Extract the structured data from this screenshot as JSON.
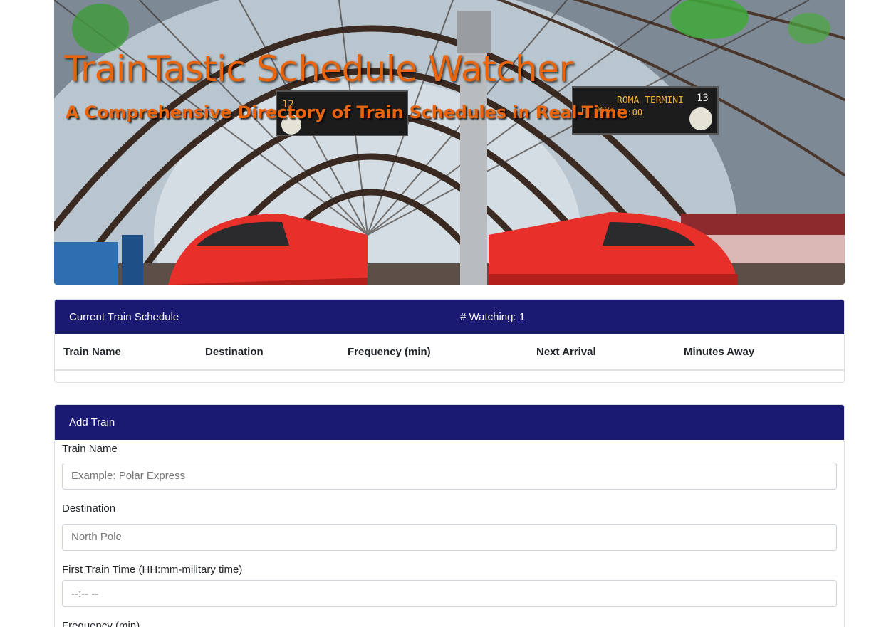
{
  "hero": {
    "title": "TrainTastic Schedule Watcher",
    "subtitle": "A Comprehensive Directory of Train Schedules in Real-Time",
    "board_left": "12",
    "board_right_platform": "13",
    "board_right_dest": "ROMA TERMINI",
    "board_right_train": "FR 9627",
    "board_right_time": "12:00"
  },
  "schedule": {
    "header": "Current Train Schedule",
    "watching": "# Watching: 1",
    "columns": [
      "Train Name",
      "Destination",
      "Frequency (min)",
      "Next Arrival",
      "Minutes Away"
    ],
    "rows": []
  },
  "add_train": {
    "header": "Add Train",
    "fields": [
      {
        "label": "Train Name",
        "placeholder": "Example: Polar Express"
      },
      {
        "label": "Destination",
        "placeholder": "North Pole"
      },
      {
        "label": "First Train Time (HH:mm-military time)",
        "placeholder": "--:-- --"
      },
      {
        "label": "Frequency (min)",
        "placeholder": ""
      }
    ]
  },
  "colors": {
    "header_bg": "#1a1a72",
    "title_orange": "#e8650e",
    "train_red": "#e8302a"
  }
}
